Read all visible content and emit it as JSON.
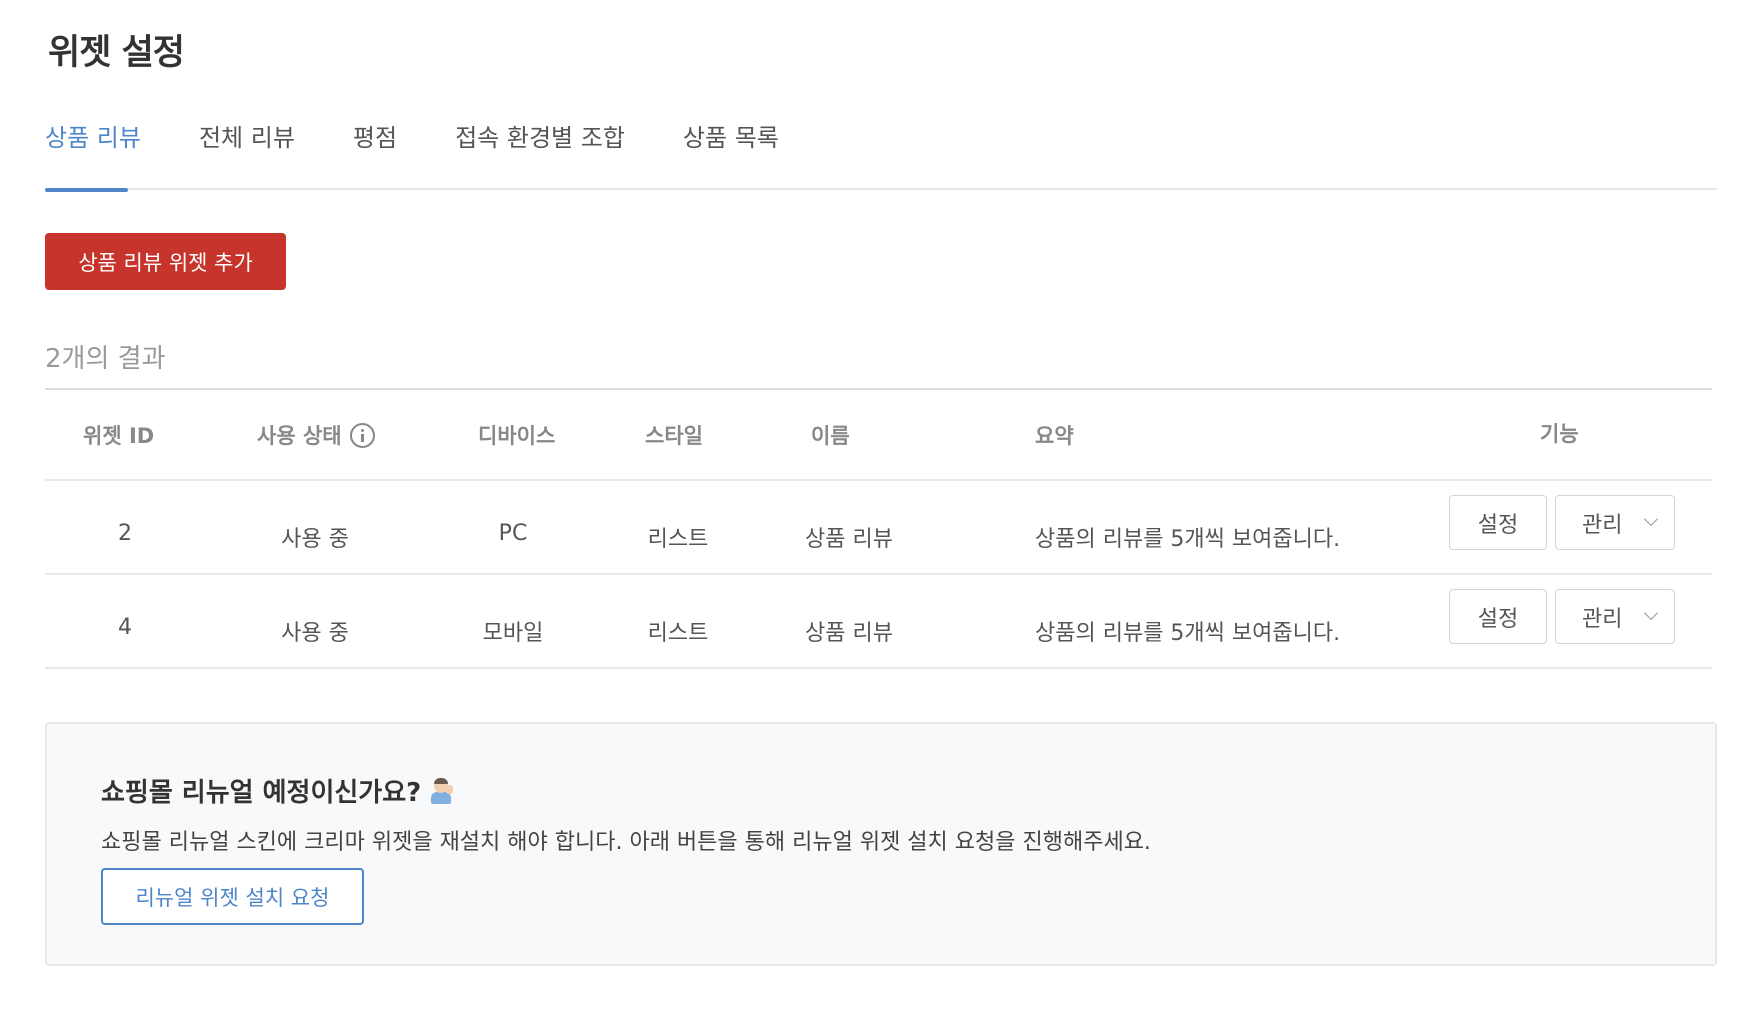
{
  "page": {
    "title": "위젯 설정"
  },
  "tabs": [
    {
      "label": "상품 리뷰",
      "active": true
    },
    {
      "label": "전체 리뷰",
      "active": false
    },
    {
      "label": "평점",
      "active": false
    },
    {
      "label": "접속 환경별 조합",
      "active": false
    },
    {
      "label": "상품 목록",
      "active": false
    }
  ],
  "toolbar": {
    "add_label": "상품 리뷰 위젯 추가"
  },
  "results": {
    "count_text": "2개의 결과"
  },
  "table": {
    "columns": {
      "id": "위젯 ID",
      "status": "사용 상태",
      "device": "디바이스",
      "style": "스타일",
      "name": "이름",
      "summary": "요약",
      "actions": "기능"
    },
    "rows": [
      {
        "id": "2",
        "status": "사용 중",
        "device": "PC",
        "style": "리스트",
        "name": "상품 리뷰",
        "summary": "상품의 리뷰를 5개씩 보여줍니다.",
        "settings_label": "설정",
        "manage_label": "관리"
      },
      {
        "id": "4",
        "status": "사용 중",
        "device": "모바일",
        "style": "리스트",
        "name": "상품 리뷰",
        "summary": "상품의 리뷰를 5개씩 보여줍니다.",
        "settings_label": "설정",
        "manage_label": "관리"
      }
    ]
  },
  "notice": {
    "title": "쇼핑몰 리뉴얼 예정이신가요?",
    "title_icon": "person-raising-hand-icon",
    "description": "쇼핑몰 리뉴얼 스킨에 크리마 위젯을 재설치 해야 합니다. 아래 버튼을 통해 리뉴얼 위젯 설치 요청을 진행해주세요.",
    "button_label": "리뉴얼 위젯 설치 요청"
  },
  "colors": {
    "accent": "#4f86c9",
    "primary_button": "#c7342c"
  }
}
